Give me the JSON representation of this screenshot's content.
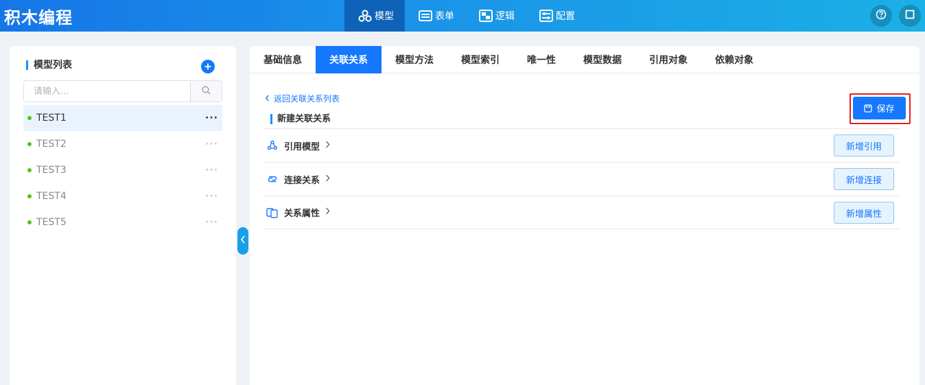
{
  "app": {
    "title": "积木编程"
  },
  "nav": {
    "items": [
      {
        "label": "模型",
        "icon": "model-icon",
        "active": true
      },
      {
        "label": "表单",
        "icon": "form-icon",
        "active": false
      },
      {
        "label": "逻辑",
        "icon": "logic-icon",
        "active": false
      },
      {
        "label": "配置",
        "icon": "config-icon",
        "active": false
      }
    ]
  },
  "sidebar": {
    "title": "模型列表",
    "search": {
      "placeholder": "请输入..."
    },
    "items": [
      {
        "name": "TEST1",
        "active": true
      },
      {
        "name": "TEST2",
        "active": false
      },
      {
        "name": "TEST3",
        "active": false
      },
      {
        "name": "TEST4",
        "active": false
      },
      {
        "name": "TEST5",
        "active": false
      }
    ],
    "more_label": "···"
  },
  "tabs": [
    {
      "label": "基础信息",
      "active": false
    },
    {
      "label": "关联关系",
      "active": true
    },
    {
      "label": "模型方法",
      "active": false
    },
    {
      "label": "模型索引",
      "active": false
    },
    {
      "label": "唯一性",
      "active": false
    },
    {
      "label": "模型数据",
      "active": false
    },
    {
      "label": "引用对象",
      "active": false
    },
    {
      "label": "依赖对象",
      "active": false
    }
  ],
  "main": {
    "back_label": "返回关联关系列表",
    "section_title": "新建关联关系",
    "save_label": "保存",
    "rows": [
      {
        "label": "引用模型",
        "icon": "reference-model-icon",
        "button": "新增引用"
      },
      {
        "label": "连接关系",
        "icon": "link-icon",
        "button": "新增连接"
      },
      {
        "label": "关系属性",
        "icon": "attribute-icon",
        "button": "新增属性"
      }
    ]
  },
  "colors": {
    "primary": "#1677ff",
    "header_start": "#1676e8",
    "header_end": "#1bb0e6",
    "status_dot": "#52c41a",
    "highlight_frame": "#e02020"
  }
}
